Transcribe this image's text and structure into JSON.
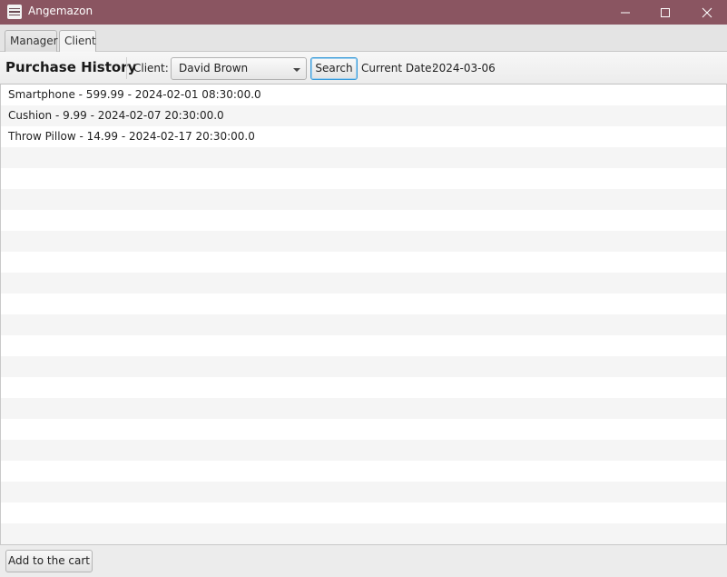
{
  "window": {
    "title": "Angemazon",
    "icons": {
      "app": "store-icon",
      "minimize": "minimize-icon",
      "maximize": "maximize-icon",
      "close": "close-icon"
    }
  },
  "tabs": [
    {
      "label": "Manager",
      "selected": false
    },
    {
      "label": "Client",
      "selected": true
    }
  ],
  "toolbar": {
    "title": "Purchase History",
    "client_label": "Client:",
    "client_value": "David Brown",
    "search_label": "Search",
    "date_label": "Current Date:",
    "date_value": "2024-03-06"
  },
  "purchases": [
    "Smartphone - 599.99 - 2024-02-01 08:30:00.0",
    "Cushion - 9.99 - 2024-02-07 20:30:00.0",
    "Throw Pillow - 14.99 - 2024-02-17 20:30:00.0"
  ],
  "footer": {
    "add_cart_label": "Add to the cart"
  },
  "colors": {
    "titlebar": "#8a5561",
    "focus": "#3a9bd9",
    "row_alt": "#f5f5f5"
  }
}
